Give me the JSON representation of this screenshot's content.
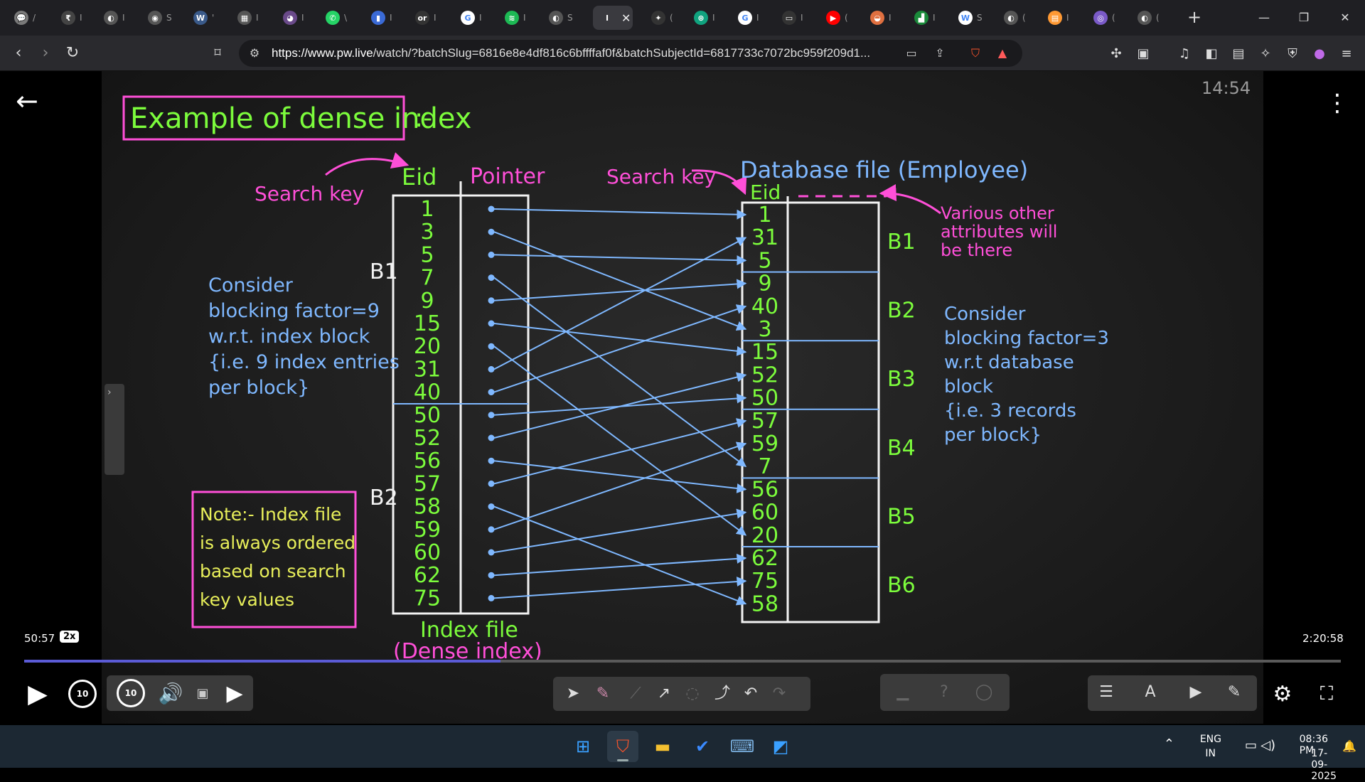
{
  "browser": {
    "tabs": [
      {
        "icon": "chat-icon",
        "color": "#7a7a7a",
        "glyph": "💬",
        "label": "/"
      },
      {
        "icon": "pw-icon",
        "color": "#444",
        "glyph": "₹",
        "label": "I"
      },
      {
        "icon": "globe-icon",
        "color": "#555",
        "glyph": "◐",
        "label": "I"
      },
      {
        "icon": "globe-icon",
        "color": "#555",
        "glyph": "◉",
        "label": "S"
      },
      {
        "icon": "w3-icon",
        "color": "#3a5a8a",
        "glyph": "W",
        "label": "'"
      },
      {
        "icon": "app-icon",
        "color": "#555",
        "glyph": "▦",
        "label": "I"
      },
      {
        "icon": "avatar-icon",
        "color": "#6a4a8a",
        "glyph": "◕",
        "label": "I"
      },
      {
        "icon": "whatsapp-icon",
        "color": "#25d366",
        "glyph": "✆",
        "label": "\\"
      },
      {
        "icon": "bookmark-icon",
        "color": "#3a6ad6",
        "glyph": "▮",
        "label": "I"
      },
      {
        "icon": "oracle-icon",
        "color": "#333",
        "glyph": "or",
        "label": "I"
      },
      {
        "icon": "google-icon",
        "color": "#ffffff",
        "glyph": "G",
        "label": "I"
      },
      {
        "icon": "spotify-icon",
        "color": "#1db954",
        "glyph": "≋",
        "label": "I"
      },
      {
        "icon": "globe-icon",
        "color": "#555",
        "glyph": "◐",
        "label": "S"
      },
      {
        "icon": "pw-icon",
        "color": "#3a3a3f",
        "glyph": "I",
        "label": "",
        "active": true
      },
      {
        "icon": "gemini-icon",
        "color": "#333",
        "glyph": "✦",
        "label": "("
      },
      {
        "icon": "chatgpt-icon",
        "color": "#10a37f",
        "glyph": "⊛",
        "label": "I"
      },
      {
        "icon": "google-icon",
        "color": "#ffffff",
        "glyph": "G",
        "label": "I"
      },
      {
        "icon": "tablet-icon",
        "color": "#333",
        "glyph": "▭",
        "label": "I"
      },
      {
        "icon": "youtube-icon",
        "color": "#ff0000",
        "glyph": "▶",
        "label": "("
      },
      {
        "icon": "burger-icon",
        "color": "#e07040",
        "glyph": "◒",
        "label": "I"
      },
      {
        "icon": "chart-icon",
        "color": "#1a8a3a",
        "glyph": "▟",
        "label": "I"
      },
      {
        "icon": "wikipedia-icon",
        "color": "#ffffff",
        "glyph": "W",
        "label": "S"
      },
      {
        "icon": "globe-icon",
        "color": "#555",
        "glyph": "◐",
        "label": "("
      },
      {
        "icon": "india-flag-icon",
        "color": "#ff9933",
        "glyph": "▤",
        "label": "I"
      },
      {
        "icon": "circle-icon",
        "color": "#7a5ac8",
        "glyph": "◎",
        "label": "("
      },
      {
        "icon": "globe-icon",
        "color": "#555",
        "glyph": "◐",
        "label": "("
      }
    ],
    "active_tab_close": "✕",
    "new_tab": "+",
    "url_host": "https://www.pw.live",
    "url_path": "/watch/?batchSlug=6816e8e4df816c6bffffaf0f&batchSubjectId=6817733c7072bc959f209d1..."
  },
  "player": {
    "overlay_time": "14:54",
    "elapsed": "50:57",
    "speed": "2x",
    "total": "2:20:58",
    "progress_fraction": 0.362,
    "rewind_label": "10",
    "forward_label": "10"
  },
  "board": {
    "title": "Example of dense index",
    "title_suffix": ":-",
    "search_key_left": "Search key",
    "eid_header": "Eid",
    "pointer_header": "Pointer",
    "search_key_right": "Search key",
    "db_file_header": "Database file (Employee)",
    "eid_header_right": "Eid",
    "index_values": [
      "1",
      "3",
      "5",
      "7",
      "9",
      "15",
      "20",
      "31",
      "40",
      "50",
      "52",
      "56",
      "57",
      "58",
      "59",
      "60",
      "62",
      "75"
    ],
    "db_values": [
      "1",
      "31",
      "5",
      "9",
      "40",
      "3",
      "15",
      "52",
      "50",
      "57",
      "59",
      "7",
      "56",
      "60",
      "20",
      "62",
      "75",
      "58"
    ],
    "index_block_labels": [
      "B1",
      "B2"
    ],
    "db_block_labels": [
      "B1",
      "B2",
      "B3",
      "B4",
      "B5",
      "B6"
    ],
    "left_note_lines": [
      "Consider",
      "blocking factor=9",
      "w.r.t. index block",
      "{i.e. 9 index entries",
      "per block}"
    ],
    "right_note_lines": [
      "Consider",
      "blocking factor=3",
      "w.r.t database",
      "block",
      "{i.e. 3 records",
      "per block}"
    ],
    "other_attr_lines": [
      "Various other",
      "attributes will",
      "be there"
    ],
    "note_box_lines": [
      "Note:- Index file",
      "is always ordered",
      "based on search",
      "key values"
    ],
    "index_file_label": "Index file",
    "dense_label": "(Dense index)"
  },
  "taskbar": {
    "lang_top": "ENG",
    "lang_bottom": "IN",
    "time": "08:36 PM",
    "date": "17-09-2025"
  },
  "colors": {
    "chalk_green": "#7CFC3C",
    "chalk_pink": "#ff4fd8",
    "chalk_blue": "#7fb8ff",
    "chalk_white": "#f2f2f2",
    "progress": "#5b5bd6"
  }
}
